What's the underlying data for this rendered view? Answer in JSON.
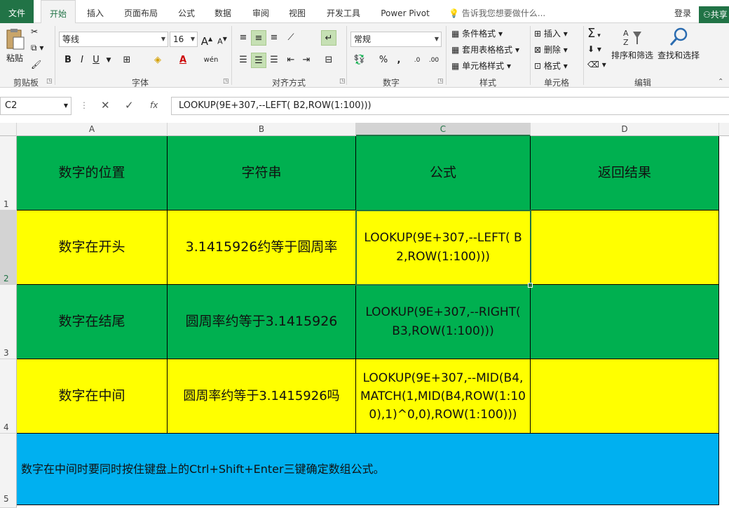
{
  "tabs": [
    {
      "label": "文件"
    },
    {
      "label": "开始"
    },
    {
      "label": "插入"
    },
    {
      "label": "页面布局"
    },
    {
      "label": "公式"
    },
    {
      "label": "数据"
    },
    {
      "label": "审阅"
    },
    {
      "label": "视图"
    },
    {
      "label": "开发工具"
    },
    {
      "label": "Power Pivot"
    }
  ],
  "tellme": "告诉我您想要做什么...",
  "login": "登录",
  "share": "共享",
  "ribbon": {
    "clipboard": {
      "label": "剪贴板",
      "paste": "粘贴"
    },
    "font": {
      "label": "字体",
      "name": "等线",
      "size": "16",
      "bold": "B",
      "italic": "I",
      "underline": "U",
      "grow": "A",
      "shrink": "A",
      "phonetic": "wén"
    },
    "align": {
      "label": "对齐方式"
    },
    "number": {
      "label": "数字",
      "format": "常规",
      "percent": "%",
      "comma": ",",
      "inc": ".0",
      "dec": ".00"
    },
    "styles": {
      "label": "样式",
      "conditional": "条件格式",
      "table": "套用表格格式",
      "cell": "单元格样式"
    },
    "cells": {
      "label": "单元格",
      "insert": "插入",
      "delete": "删除",
      "format": "格式"
    },
    "editing": {
      "label": "编辑",
      "sum": "Σ",
      "sort": "排序和筛选",
      "find": "查找和选择"
    }
  },
  "formula_bar": {
    "name_box": "C2",
    "formula": "LOOKUP(9E+307,--LEFT( B2,ROW(1:100)))",
    "fx": "fx"
  },
  "columns": [
    "A",
    "B",
    "C",
    "D"
  ],
  "rows": [
    "1",
    "2",
    "3",
    "4",
    "5"
  ],
  "grid": {
    "r1": {
      "a": "数字的位置",
      "b": "字符串",
      "c": "公式",
      "d": "返回结果"
    },
    "r2": {
      "a": "数字在开头",
      "b": "3.1415926约等于圆周率",
      "c": "LOOKUP(9E+307,--LEFT( B2,ROW(1:100)))",
      "d": ""
    },
    "r3": {
      "a": "数字在结尾",
      "b": "圆周率约等于3.1415926",
      "c": "LOOKUP(9E+307,--RIGHT( B3,ROW(1:100)))",
      "d": ""
    },
    "r4": {
      "a": "数字在中间",
      "b": "圆周率约等于3.1415926吗",
      "c": "LOOKUP(9E+307,--MID(B4,MATCH(1,MID(B4,ROW(1:100),1)^0,0),ROW(1:100)))",
      "d": ""
    },
    "r5": {
      "note": "数字在中间时要同时按住键盘上的Ctrl+Shift+Enter三键确定数组公式。"
    }
  },
  "colors": {
    "green": "#00b050",
    "yellow": "#ffff00",
    "blue": "#00b0f0",
    "accent": "#217346"
  }
}
